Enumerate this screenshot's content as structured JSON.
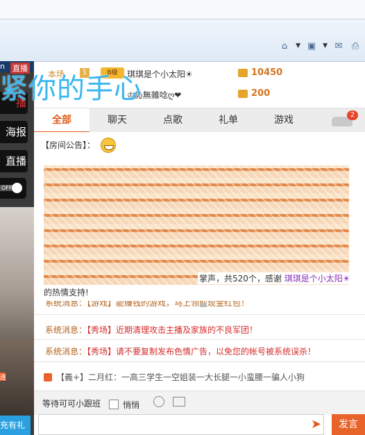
{
  "left_panel": {
    "live_tag": "直播",
    "strip_text": "n",
    "menu": [
      "播",
      "海报",
      "直播"
    ],
    "toggle_off": "OFF",
    "bottom_button": "充有礼",
    "orange_tag": "连"
  },
  "overlay_title": "紧你的手心",
  "rank": [
    {
      "label": "本场",
      "num": "1",
      "badge": "B级",
      "name": "琪琪是个小太阳☀",
      "value": "10450"
    },
    {
      "label": "",
      "num": "",
      "badge": "",
      "name": "♔訫無雜唸ღ❤",
      "value": "200"
    }
  ],
  "tabs": [
    "全部",
    "聊天",
    "点歌",
    "礼单",
    "游戏"
  ],
  "tab_badge": "2",
  "chat": {
    "notice_label": "【房间公告】：",
    "gift_line_a": "掌声，共520个，感谢 ",
    "gift_user": "琪琪是个小太阳☀",
    "gift_line_b": "的热情支持!",
    "partial_msg": "系统消息：【游戏】能赚钱的游戏，马上领取现金红包！",
    "sys_messages": [
      {
        "prefix": "系统消息：",
        "tag": "【秀场】",
        "text": "近期清理攻击主播及家族的不良军团！"
      },
      {
        "prefix": "系统消息：",
        "tag": "【秀场】",
        "text": "请不要复制发布色情广告，以免您的帐号被系统误杀！"
      }
    ],
    "announcement": "【義+】二月红：一高三学生一空姐装一大长腿一小蛮腰一骗人小狗"
  },
  "input": {
    "target": "等待可可小跟班",
    "whisper": "悄悄",
    "send": "发言"
  }
}
